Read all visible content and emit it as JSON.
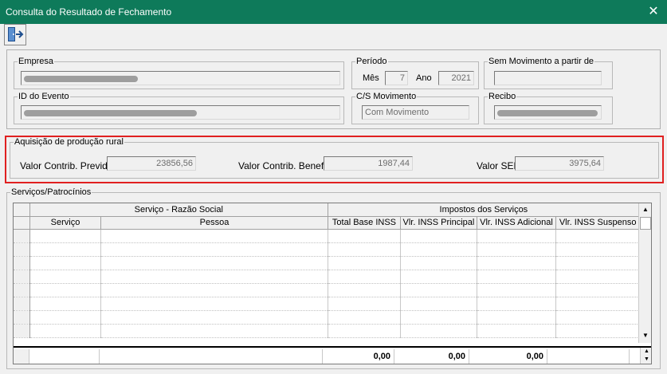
{
  "window": {
    "title": "Consulta do Resultado de Fechamento"
  },
  "toolbar": {
    "exit_icon": "exit-door-icon"
  },
  "header": {
    "empresa_label": "Empresa",
    "periodo_label": "Período",
    "mes_label": "Mês",
    "mes_value": "7",
    "ano_label": "Ano",
    "ano_value": "2021",
    "sem_mov_label": "Sem Movimento a partir de",
    "sem_mov_value": "",
    "id_evento_label": "ID do Evento",
    "cs_mov_label": "C/S Movimento",
    "cs_mov_value": "Com Movimento",
    "recibo_label": "Recibo"
  },
  "aquisicao": {
    "title": "Aquisição de produção rural",
    "previd_label": "Valor Contrib. Previd.",
    "previd_value": "23856,56",
    "benef_label": "Valor Contrib. Benef.",
    "benef_value": "1987,44",
    "senar_label": "Valor SENAR",
    "senar_value": "3975,64"
  },
  "servicos": {
    "title": "Serviços/Patrocínios",
    "group1": "Serviço - Razão Social",
    "group2": "Impostos dos Serviços",
    "columns": [
      "Serviço",
      "Pessoa",
      "Total Base INSS",
      "Vlr. INSS Principal",
      "Vlr. INSS Adicional",
      "Vlr. INSS Suspenso"
    ],
    "totals": [
      "0,00",
      "0,00",
      "0,00"
    ]
  }
}
